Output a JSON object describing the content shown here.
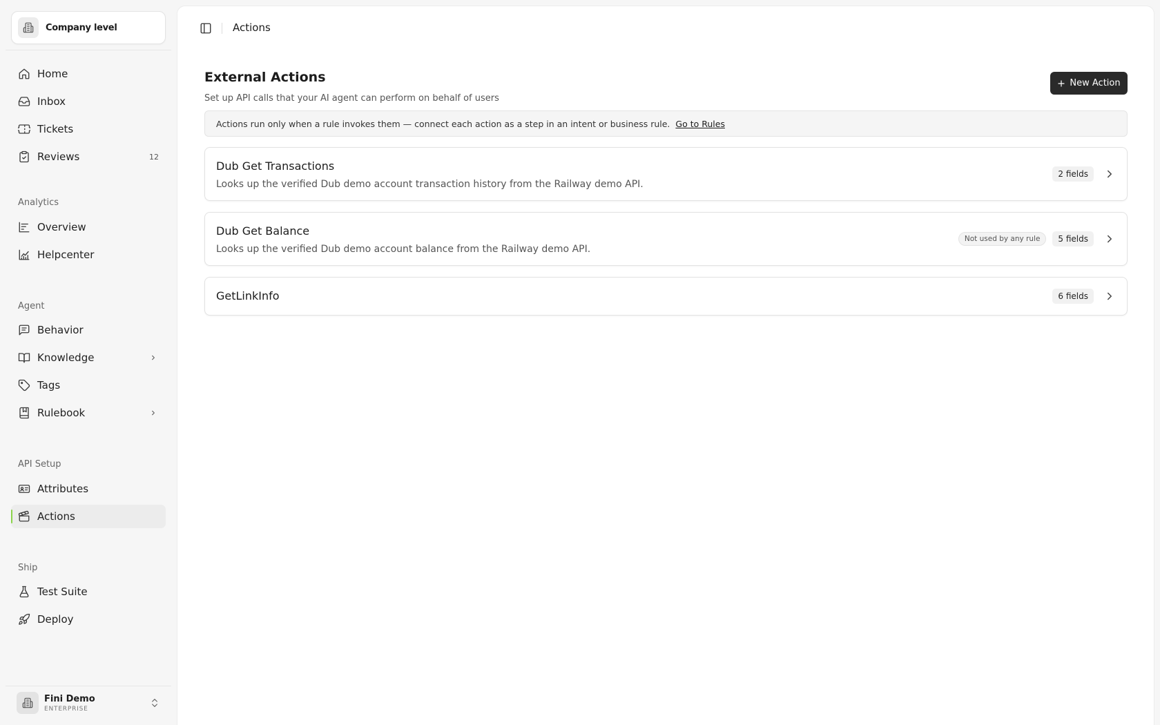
{
  "sidebar": {
    "company_switch": {
      "label": "Company level",
      "icon": "building-icon"
    },
    "sections": {
      "analytics": "Analytics",
      "agent": "Agent",
      "api_setup": "API Setup",
      "ship": "Ship"
    },
    "items": {
      "home": {
        "label": "Home",
        "icon": "home-icon"
      },
      "inbox": {
        "label": "Inbox",
        "icon": "inbox-icon"
      },
      "tickets": {
        "label": "Tickets",
        "icon": "ticket-icon"
      },
      "reviews": {
        "label": "Reviews",
        "icon": "clipboard-check-icon",
        "badge": "12"
      },
      "overview": {
        "label": "Overview",
        "icon": "bar-chart-icon"
      },
      "helpcenter": {
        "label": "Helpcenter",
        "icon": "line-chart-icon"
      },
      "behavior": {
        "label": "Behavior",
        "icon": "message-square-icon"
      },
      "knowledge": {
        "label": "Knowledge",
        "icon": "book-open-icon"
      },
      "tags": {
        "label": "Tags",
        "icon": "tag-icon"
      },
      "rulebook": {
        "label": "Rulebook",
        "icon": "book-marked-icon"
      },
      "attributes": {
        "label": "Attributes",
        "icon": "id-card-icon"
      },
      "actions": {
        "label": "Actions",
        "icon": "clapperboard-icon",
        "active": true
      },
      "test_suite": {
        "label": "Test Suite",
        "icon": "flask-icon"
      },
      "deploy": {
        "label": "Deploy",
        "icon": "rocket-icon"
      }
    },
    "account": {
      "name": "Fini Demo",
      "plan": "ENTERPRISE"
    }
  },
  "topbar": {
    "breadcrumb": "Actions"
  },
  "main": {
    "title": "External Actions",
    "subtitle": "Set up API calls that your AI agent can perform on behalf of users",
    "new_button": "New Action",
    "notice": {
      "text": "Actions run only when a rule invokes them — connect each action as a step in an intent or business rule.",
      "link": "Go to Rules"
    },
    "actions": [
      {
        "name": "Dub Get Transactions",
        "description": "Looks up the verified Dub demo account transaction history from the Railway demo API.",
        "fields": "2 fields"
      },
      {
        "name": "Dub Get Balance",
        "description": "Looks up the verified Dub demo account balance from the Railway demo API.",
        "status": "Not used by any rule",
        "fields": "5 fields"
      },
      {
        "name": "GetLinkInfo",
        "fields": "6 fields"
      }
    ]
  },
  "colors": {
    "active_indicator": "#8bd34a",
    "primary_button": "#2a2a2a",
    "background": "#f6f6f6"
  }
}
